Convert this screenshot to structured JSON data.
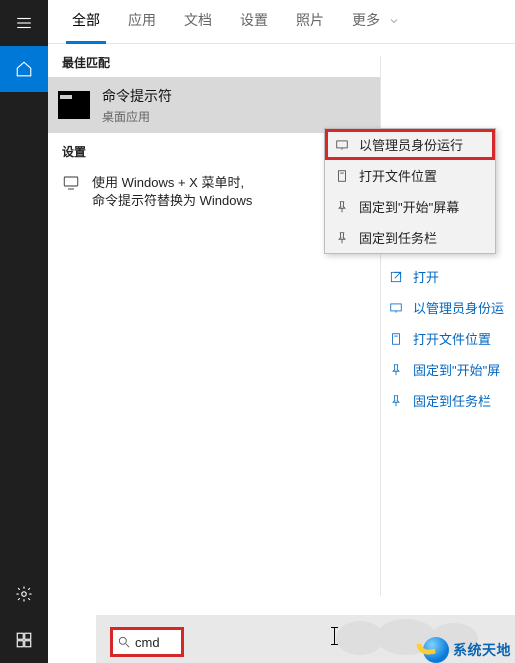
{
  "tabs": {
    "all": "全部",
    "apps": "应用",
    "docs": "文档",
    "settings": "设置",
    "photos": "照片",
    "more": "更多"
  },
  "sections": {
    "best_match": "最佳匹配",
    "settings": "设置"
  },
  "best_match": {
    "title": "命令提示符",
    "subtitle": "桌面应用"
  },
  "setting_item": {
    "line1": "使用 Windows + X 菜单时,",
    "line2": "命令提示符替换为 Windows"
  },
  "context_menu": {
    "run_admin": "以管理员身份运行",
    "open_location": "打开文件位置",
    "pin_start": "固定到\"开始\"屏幕",
    "pin_taskbar": "固定到任务栏"
  },
  "preview_links": {
    "open": "打开",
    "run_admin": "以管理员身份运",
    "open_location": "打开文件位置",
    "pin_start": "固定到\"开始\"屏",
    "pin_taskbar": "固定到任务栏"
  },
  "search": {
    "value": "cmd"
  },
  "watermark": {
    "text": "系统天地"
  }
}
